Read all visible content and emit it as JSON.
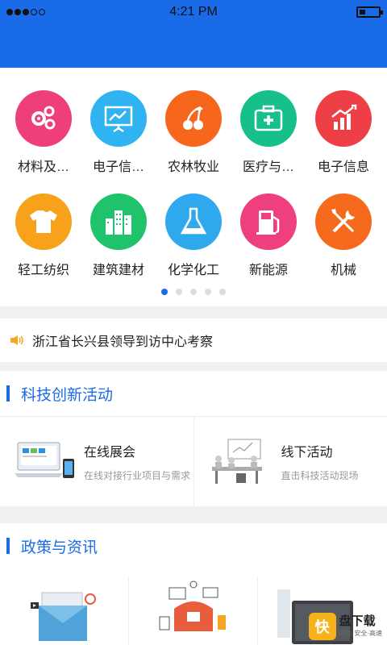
{
  "status": {
    "time": "4:21 PM"
  },
  "categories": [
    {
      "label": "材料及…",
      "color": "#ee3f78",
      "icon": "gears-icon"
    },
    {
      "label": "电子信…",
      "color": "#2fb3f1",
      "icon": "presentation-board-icon"
    },
    {
      "label": "农林牧业",
      "color": "#f7661d",
      "icon": "cherries-icon"
    },
    {
      "label": "医疗与…",
      "color": "#17c08a",
      "icon": "medical-kit-icon"
    },
    {
      "label": "电子信息",
      "color": "#ef3f46",
      "icon": "bar-chart-up-icon"
    },
    {
      "label": "轻工纺织",
      "color": "#f7a21a",
      "icon": "tshirt-icon"
    },
    {
      "label": "建筑建材",
      "color": "#1fc36b",
      "icon": "buildings-icon"
    },
    {
      "label": "化学化工",
      "color": "#2fa9ee",
      "icon": "flask-icon"
    },
    {
      "label": "新能源",
      "color": "#ee3f7f",
      "icon": "fuel-pump-icon"
    },
    {
      "label": "机械",
      "color": "#f56a1c",
      "icon": "tools-icon"
    }
  ],
  "pager": {
    "total": 5,
    "active": 1
  },
  "notice": {
    "text": "浙江省长兴县领导到访中心考察"
  },
  "section_activities": {
    "title": "科技创新活动"
  },
  "activities": [
    {
      "title": "在线展会",
      "subtitle": "在线对接行业项目与需求"
    },
    {
      "title": "线下活动",
      "subtitle": "直击科技活动现场"
    }
  ],
  "section_news": {
    "title": "政策与资讯"
  },
  "watermark": {
    "char": "快",
    "title": "盘下载",
    "sub": "绿色·安全·高速"
  },
  "colors": {
    "brand_blue": "#1a6be8",
    "background": "#f1f1f1"
  }
}
